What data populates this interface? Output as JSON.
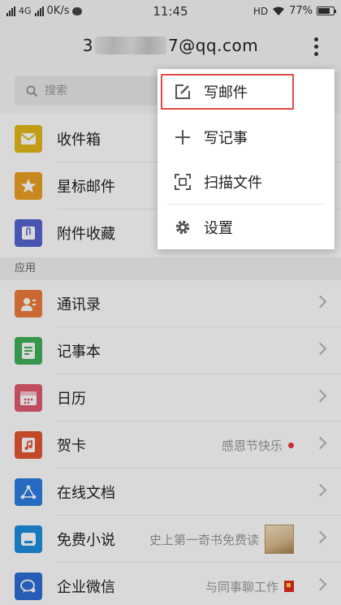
{
  "status_bar": {
    "carrier": "4G",
    "speed": "0K/s",
    "time": "11:45",
    "hd": "HD",
    "battery": "77%"
  },
  "header": {
    "account_prefix": "3",
    "account_suffix": "7@qq.com"
  },
  "search": {
    "placeholder": "搜索"
  },
  "mailboxes": [
    {
      "label": "收件箱",
      "icon": "inbox-icon",
      "color": "#e3b818"
    },
    {
      "label": "星标邮件",
      "icon": "star-icon",
      "color": "#eda024"
    },
    {
      "label": "附件收藏",
      "icon": "attachment-icon",
      "color": "#5565d2"
    }
  ],
  "section_label": "应用",
  "apps": [
    {
      "label": "通讯录",
      "icon": "contacts-icon",
      "color": "#ee7c3a",
      "sub": ""
    },
    {
      "label": "记事本",
      "icon": "notebook-icon",
      "color": "#3fb15a",
      "sub": ""
    },
    {
      "label": "日历",
      "icon": "calendar-icon",
      "color": "#e35a6e",
      "sub": ""
    },
    {
      "label": "贺卡",
      "icon": "greeting-card-icon",
      "color": "#e45833",
      "sub": "感恩节快乐"
    },
    {
      "label": "在线文档",
      "icon": "online-doc-icon",
      "color": "#2d7de3",
      "sub": ""
    },
    {
      "label": "免费小说",
      "icon": "novel-icon",
      "color": "#1e8fe0",
      "sub": "史上第一奇书免费读"
    },
    {
      "label": "企业微信",
      "icon": "wework-icon",
      "color": "#2d6fd8",
      "sub": "与同事聊工作"
    }
  ],
  "menu": {
    "items": [
      {
        "label": "写邮件",
        "icon": "compose-icon"
      },
      {
        "label": "写记事",
        "icon": "plus-icon"
      },
      {
        "label": "扫描文件",
        "icon": "scan-icon"
      },
      {
        "label": "设置",
        "icon": "gear-icon"
      }
    ]
  }
}
